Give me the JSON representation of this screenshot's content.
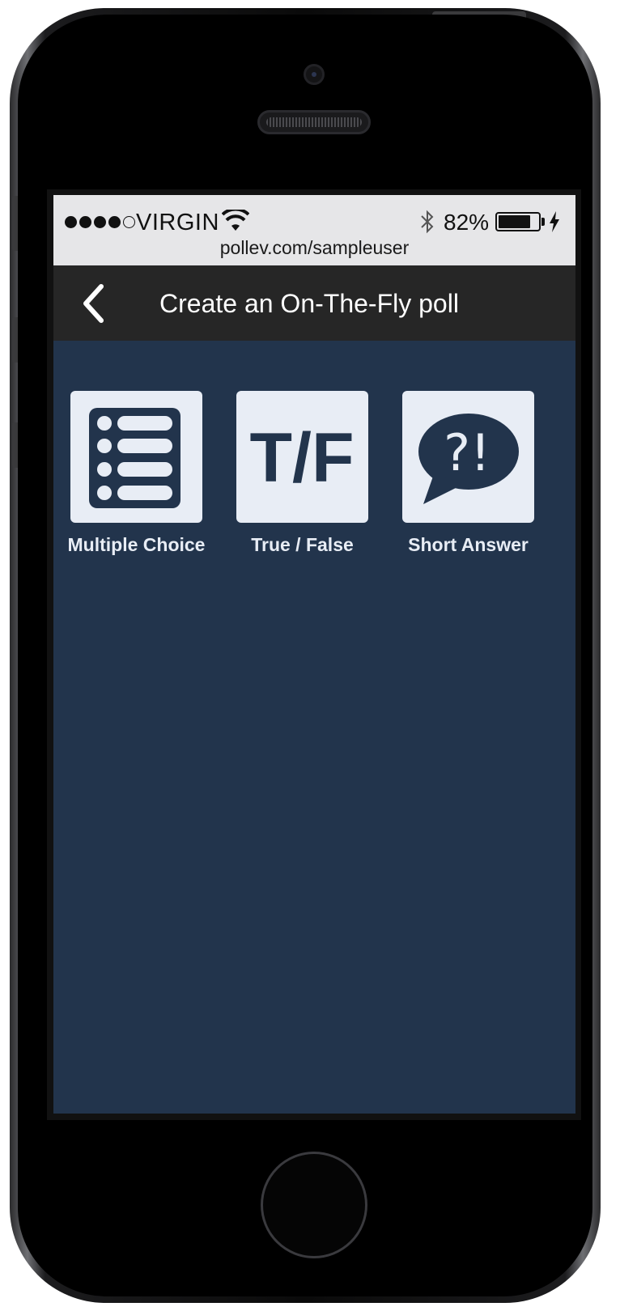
{
  "status_bar": {
    "carrier": "VIRGIN",
    "battery_percent": "82%",
    "battery_level": 0.82,
    "url": "pollev.com/sampleuser",
    "signal_bars_filled": 4,
    "signal_bars_total": 5
  },
  "nav": {
    "title": "Create an On-The-Fly poll",
    "back_icon": "chevron-left-icon"
  },
  "poll_types": [
    {
      "label": "Multiple Choice",
      "icon": "multiple-choice-list-icon"
    },
    {
      "label": "True / False",
      "icon": "true-false-icon",
      "icon_text": "T/F"
    },
    {
      "label": "Short Answer",
      "icon": "speech-bubble-question-exclamation-icon",
      "icon_text": "?!"
    }
  ],
  "colors": {
    "background": "#22344c",
    "nav_bar": "#262626",
    "tile": "#e8edf5",
    "icon": "#22344c"
  }
}
